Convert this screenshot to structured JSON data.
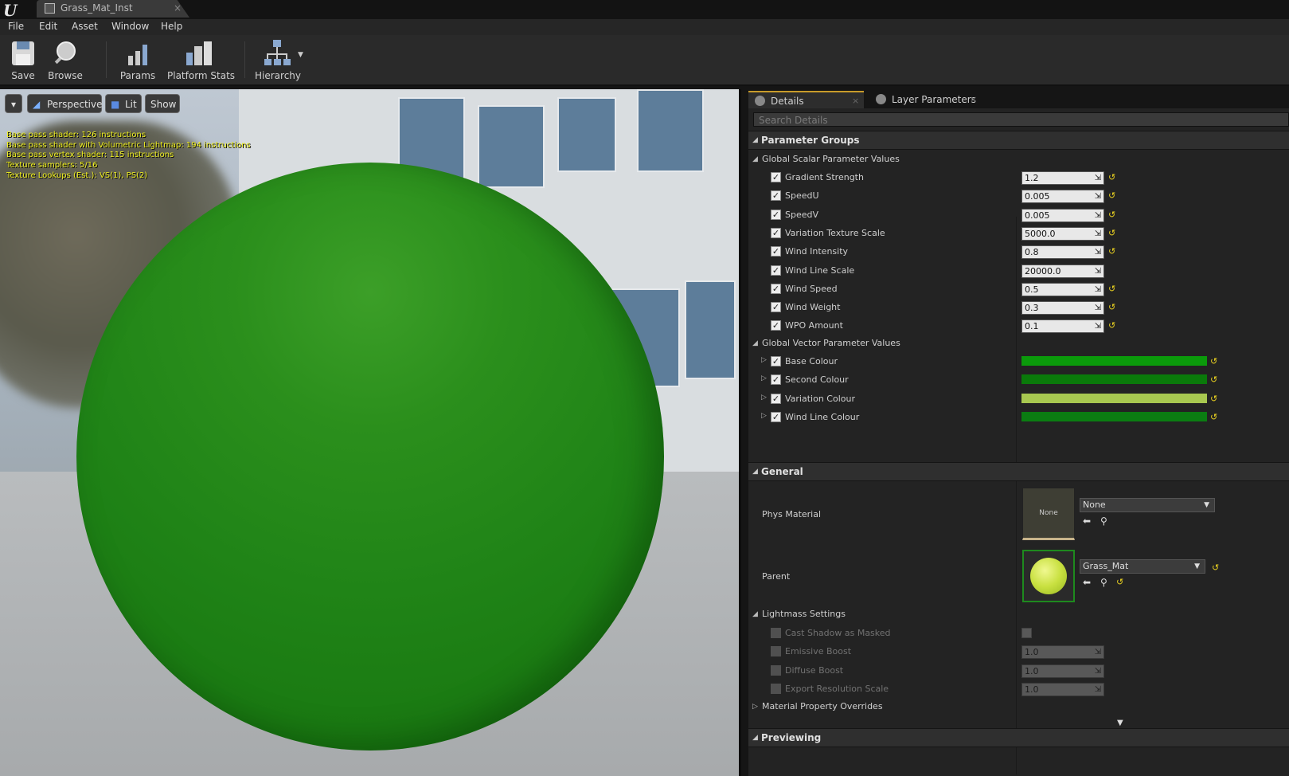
{
  "window": {
    "tab_title": "Grass_Mat_Inst",
    "tab_close": "×"
  },
  "menu": [
    "File",
    "Edit",
    "Asset",
    "Window",
    "Help"
  ],
  "toolbar": {
    "save": "Save",
    "browse": "Browse",
    "params": "Params",
    "platform_stats": "Platform Stats",
    "hierarchy": "Hierarchy"
  },
  "viewport": {
    "dropdown": "▾",
    "perspective": "Perspective",
    "lit": "Lit",
    "show": "Show",
    "stats": [
      "Base pass shader: 126 instructions",
      "Base pass shader with Volumetric Lightmap: 194 instructions",
      "Base pass vertex shader: 115 instructions",
      "Texture samplers: 5/16",
      "Texture Lookups (Est.): VS(1), PS(2)"
    ]
  },
  "details": {
    "tabs": [
      {
        "label": "Details",
        "close": "×"
      },
      {
        "label": "Layer Parameters",
        "close": "×"
      }
    ],
    "search_placeholder": "Search Details",
    "sections": {
      "parameter_groups": "Parameter Groups",
      "general": "General",
      "previewing": "Previewing"
    },
    "categories": {
      "scalar": "Global Scalar Parameter Values",
      "vector": "Global Vector Parameter Values",
      "lightmass": "Lightmass Settings",
      "overrides": "Material Property Overrides"
    },
    "scalar_params": [
      {
        "name": "Gradient Strength",
        "value": "1.2",
        "reset": true
      },
      {
        "name": "SpeedU",
        "value": "0.005",
        "reset": true
      },
      {
        "name": "SpeedV",
        "value": "0.005",
        "reset": true
      },
      {
        "name": "Variation Texture Scale",
        "value": "5000.0",
        "reset": true
      },
      {
        "name": "Wind Intensity",
        "value": "0.8",
        "reset": true
      },
      {
        "name": "Wind Line Scale",
        "value": "20000.0",
        "reset": false
      },
      {
        "name": "Wind Speed",
        "value": "0.5",
        "reset": true
      },
      {
        "name": "Wind Weight",
        "value": "0.3",
        "reset": true
      },
      {
        "name": "WPO Amount",
        "value": "0.1",
        "reset": true
      }
    ],
    "vector_params": [
      {
        "name": "Base Colour",
        "color": "#0b9a0b"
      },
      {
        "name": "Second Colour",
        "color": "#0a7a0a"
      },
      {
        "name": "Variation Colour",
        "color": "#a8c850"
      },
      {
        "name": "Wind Line Colour",
        "color": "#0b7d12"
      }
    ],
    "general": {
      "phys_material_label": "Phys Material",
      "phys_material_thumb": "None",
      "phys_material_value": "None",
      "parent_label": "Parent",
      "parent_value": "Grass_Mat"
    },
    "lightmass": [
      {
        "name": "Cast Shadow as Masked",
        "value": null
      },
      {
        "name": "Emissive Boost",
        "value": "1.0"
      },
      {
        "name": "Diffuse Boost",
        "value": "1.0"
      },
      {
        "name": "Export Resolution Scale",
        "value": "1.0"
      }
    ]
  },
  "icons": {
    "check": "✓",
    "expand": "▷",
    "collapse": "◢",
    "reset": "↺",
    "spin": "⇲",
    "dropdown": "▼",
    "arrow_left": "⬅",
    "search": "⚲"
  }
}
